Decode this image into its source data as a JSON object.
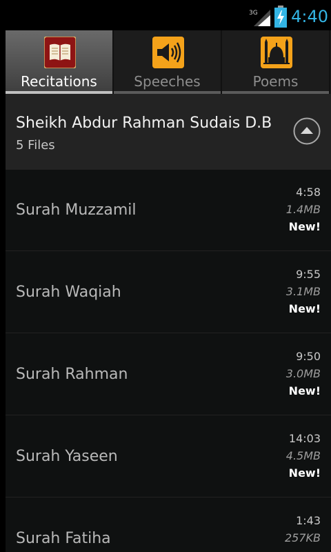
{
  "status_bar": {
    "network": "3G",
    "time": "4:40"
  },
  "tabs": [
    {
      "label": "Recitations",
      "icon": "quran-book-icon",
      "selected": true
    },
    {
      "label": "Speeches",
      "icon": "speaker-icon",
      "selected": false
    },
    {
      "label": "Poems",
      "icon": "mosque-icon",
      "selected": false
    }
  ],
  "group": {
    "title": "Sheikh Abdur Rahman Sudais D.B",
    "subtitle": "5 Files",
    "collapse_icon": "collapse-up-icon"
  },
  "items": [
    {
      "title": "Surah Muzzamil",
      "duration": "4:58",
      "size": "1.4MB",
      "badge": "New!"
    },
    {
      "title": "Surah Waqiah",
      "duration": "9:55",
      "size": "3.1MB",
      "badge": "New!"
    },
    {
      "title": "Surah Rahman",
      "duration": "9:50",
      "size": "3.0MB",
      "badge": "New!"
    },
    {
      "title": "Surah Yaseen",
      "duration": "14:03",
      "size": "4.5MB",
      "badge": "New!"
    },
    {
      "title": "Surah Fatiha",
      "duration": "1:43",
      "size": "257KB",
      "badge": ""
    }
  ],
  "colors": {
    "accent": "#33b5e5",
    "tab_icon_bg": "#f4a21a",
    "book_icon_bg": "#8e1414"
  }
}
